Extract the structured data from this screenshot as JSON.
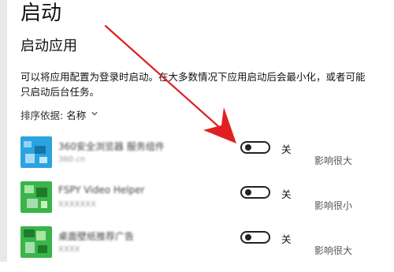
{
  "page": {
    "title": "启动"
  },
  "section": {
    "title": "启动应用",
    "description": "可以将应用配置为登录时启动。在大多数情况下应用启动后会最小化，或者可能只启动后台任务。",
    "sort_label": "排序依据:",
    "sort_value": "名称"
  },
  "apps": [
    {
      "name": "360安全浏览器 服务组件",
      "publisher": "360.cn",
      "toggle_label": "关",
      "impact": "影响很大",
      "enabled": false,
      "icon_color": "#2aa3e0"
    },
    {
      "name": "FSPY Video Helper",
      "publisher": "XXXXXXX",
      "toggle_label": "关",
      "impact": "影响很小",
      "enabled": false,
      "icon_color": "#39b54a"
    },
    {
      "name": "桌面壁纸推荐广告",
      "publisher": "XXXX",
      "toggle_label": "关",
      "impact": "影响很大",
      "enabled": false,
      "icon_color": "#39b54a"
    }
  ],
  "annotation": {
    "arrow_color": "#e02020"
  }
}
